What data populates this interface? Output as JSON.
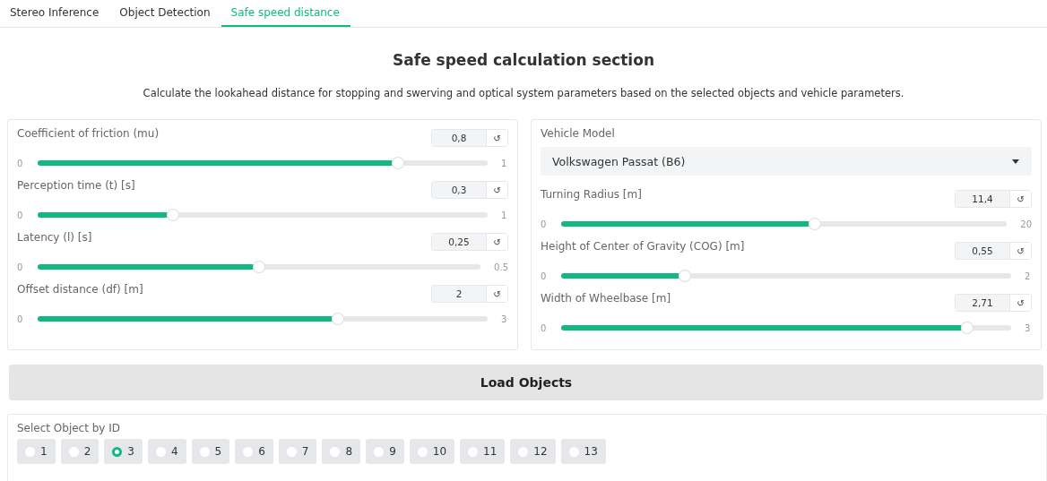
{
  "tabs": [
    {
      "label": "Stereo Inference",
      "selected": false
    },
    {
      "label": "Object Detection",
      "selected": false
    },
    {
      "label": "Safe speed distance",
      "selected": true
    }
  ],
  "title": "Safe speed calculation section",
  "description": "Calculate the lookahead distance for stopping and swerving and optical system parameters based on the selected objects and vehicle parameters.",
  "left_sliders": [
    {
      "label": "Coefficient of friction (mu)",
      "value": "0,8",
      "reset": "↺",
      "min": "0",
      "max": "1",
      "level": 0.8
    },
    {
      "label": "Perception time (t) [s]",
      "value": "0,3",
      "reset": "↺",
      "min": "0",
      "max": "1",
      "level": 0.3
    },
    {
      "label": "Latency (l) [s]",
      "value": "0,25",
      "reset": "↺",
      "min": "0",
      "max": "0.5",
      "level": 0.5
    },
    {
      "label": "Offset distance (df) [m]",
      "value": "2",
      "reset": "↺",
      "min": "0",
      "max": "3",
      "level": 0.667
    }
  ],
  "vehicle_model": {
    "label": "Vehicle Model",
    "value": "Volkswagen Passat (B6)"
  },
  "right_sliders": [
    {
      "label": "Turning Radius [m]",
      "value": "11,4",
      "reset": "↺",
      "min": "0",
      "max": "20",
      "level": 0.57
    },
    {
      "label": "Height of Center of Gravity (COG) [m]",
      "value": "0,55",
      "reset": "↺",
      "min": "0",
      "max": "2",
      "level": 0.275
    },
    {
      "label": "Width of Wheelbase [m]",
      "value": "2,71",
      "reset": "↺",
      "min": "0",
      "max": "3",
      "level": 0.903
    }
  ],
  "load_button": "Load Objects",
  "object_select": {
    "label": "Select Object by ID",
    "options": [
      {
        "label": "1",
        "selected": false
      },
      {
        "label": "2",
        "selected": false
      },
      {
        "label": "3",
        "selected": true
      },
      {
        "label": "4",
        "selected": false
      },
      {
        "label": "5",
        "selected": false
      },
      {
        "label": "6",
        "selected": false
      },
      {
        "label": "7",
        "selected": false
      },
      {
        "label": "8",
        "selected": false
      },
      {
        "label": "9",
        "selected": false
      },
      {
        "label": "10",
        "selected": false
      },
      {
        "label": "11",
        "selected": false
      },
      {
        "label": "12",
        "selected": false
      },
      {
        "label": "13",
        "selected": false
      }
    ]
  }
}
